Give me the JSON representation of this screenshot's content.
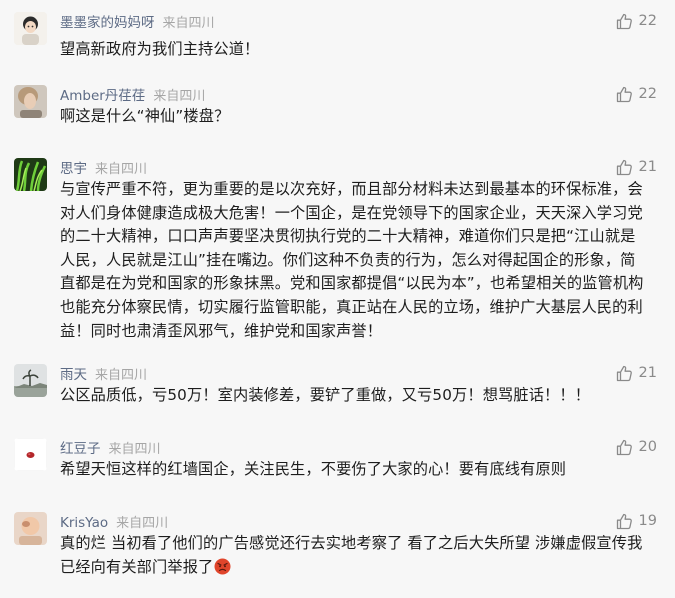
{
  "comments": [
    {
      "name": "墨墨家的妈妈呀",
      "location": "来自四川",
      "likes": "22",
      "text": "望高新政府为我们主持公道！"
    },
    {
      "name": "Amber丹荏荏",
      "location": "来自四川",
      "likes": "22",
      "text": "啊这是什么“神仙”楼盘？"
    },
    {
      "name": "思宇",
      "location": "来自四川",
      "likes": "21",
      "text": "与宣传严重不符，更为重要的是以次充好，而且部分材料未达到最基本的环保标准，会对人们身体健康造成极大危害！一个国企，是在党领导下的国家企业，天天深入学习党的二十大精神，口口声声要坚决贯彻执行党的二十大精神，难道你们只是把“江山就是人民，人民就是江山”挂在嘴边。你们这种不负责的行为，怎么对得起国企的形象，简直都是在为党和国家的形象抹黑。党和国家都提倡“以民为本”，也希望相关的监管机构也能充分体察民情，切实履行监管职能，真正站在人民的立场，维护广大基层人民的利益！同时也肃清歪风邪气，维护党和国家声誉！"
    },
    {
      "name": "雨天",
      "location": "来自四川",
      "likes": "21",
      "text": "公区品质低，亏50万！室内装修差，要铲了重做，又亏50万！想骂脏话！！！"
    },
    {
      "name": "红豆子",
      "location": "来自四川",
      "likes": "20",
      "text": "希望天恒这样的红墙国企，关注民生，不要伤了大家的心！要有底线有原则"
    },
    {
      "name": "KrisYao",
      "location": "来自四川",
      "likes": "19",
      "text": "真的烂 当初看了他们的广告感觉还行去实地考察了 看了之后大失所望 涉嫌虚假宣传我已经向有关部门举报了",
      "emoji": "angry-face"
    }
  ]
}
